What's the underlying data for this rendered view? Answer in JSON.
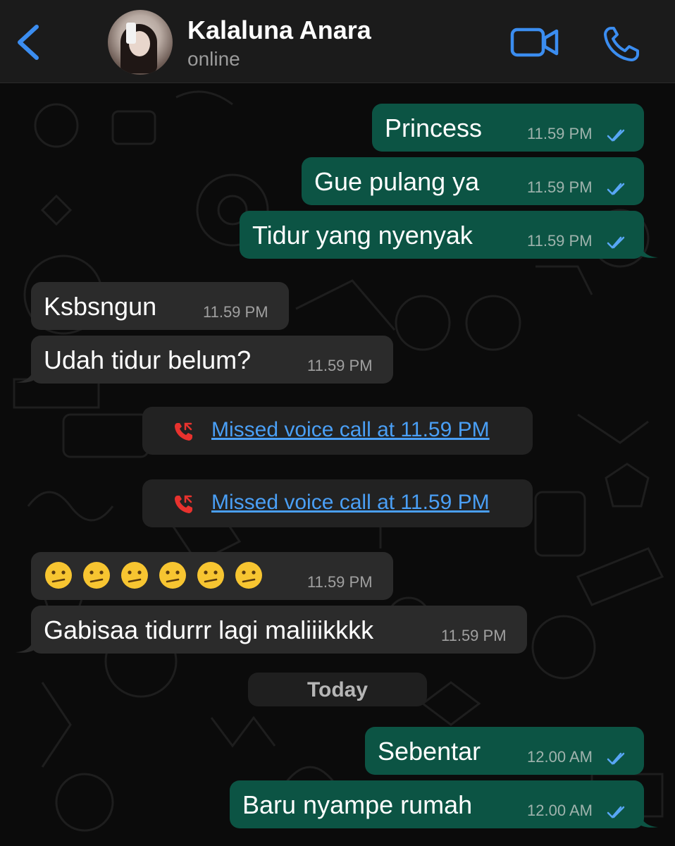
{
  "header": {
    "contact_name": "Kalaluna Anara",
    "status": "online",
    "accent_color": "#3b8df0"
  },
  "messages": [
    {
      "direction": "out",
      "text": "Princess",
      "time": "11.59 PM",
      "status": "read"
    },
    {
      "direction": "out",
      "text": "Gue pulang ya",
      "time": "11.59 PM",
      "status": "read"
    },
    {
      "direction": "out",
      "text": "Tidur yang nyenyak",
      "time": "11.59 PM",
      "status": "read"
    },
    {
      "direction": "in",
      "text": "Ksbsngun",
      "time": "11.59 PM"
    },
    {
      "direction": "in",
      "text": "Udah tidur belum?",
      "time": "11.59 PM"
    },
    {
      "type": "missed-call",
      "text": "Missed voice call at 11.59 PM"
    },
    {
      "type": "missed-call",
      "text": "Missed voice call at 11.59 PM"
    },
    {
      "direction": "in",
      "emoji": "confused-face",
      "emoji_count": 6,
      "time": "11.59 PM"
    },
    {
      "direction": "in",
      "text": "Gabisaa tidurrr lagi maliiikkkk",
      "time": "11.59 PM"
    },
    {
      "type": "date-separator",
      "text": "Today"
    },
    {
      "direction": "out",
      "text": "Sebentar",
      "time": "12.00 AM",
      "status": "read"
    },
    {
      "direction": "out",
      "text": "Baru nyampe rumah",
      "time": "12.00 AM",
      "status": "read"
    }
  ],
  "colors": {
    "outgoing_bubble": "#0c5444",
    "incoming_bubble": "#2b2b2b",
    "read_ticks": "#58a6f5",
    "missed_call_icon": "#e8322e",
    "link": "#4a9ff5"
  }
}
